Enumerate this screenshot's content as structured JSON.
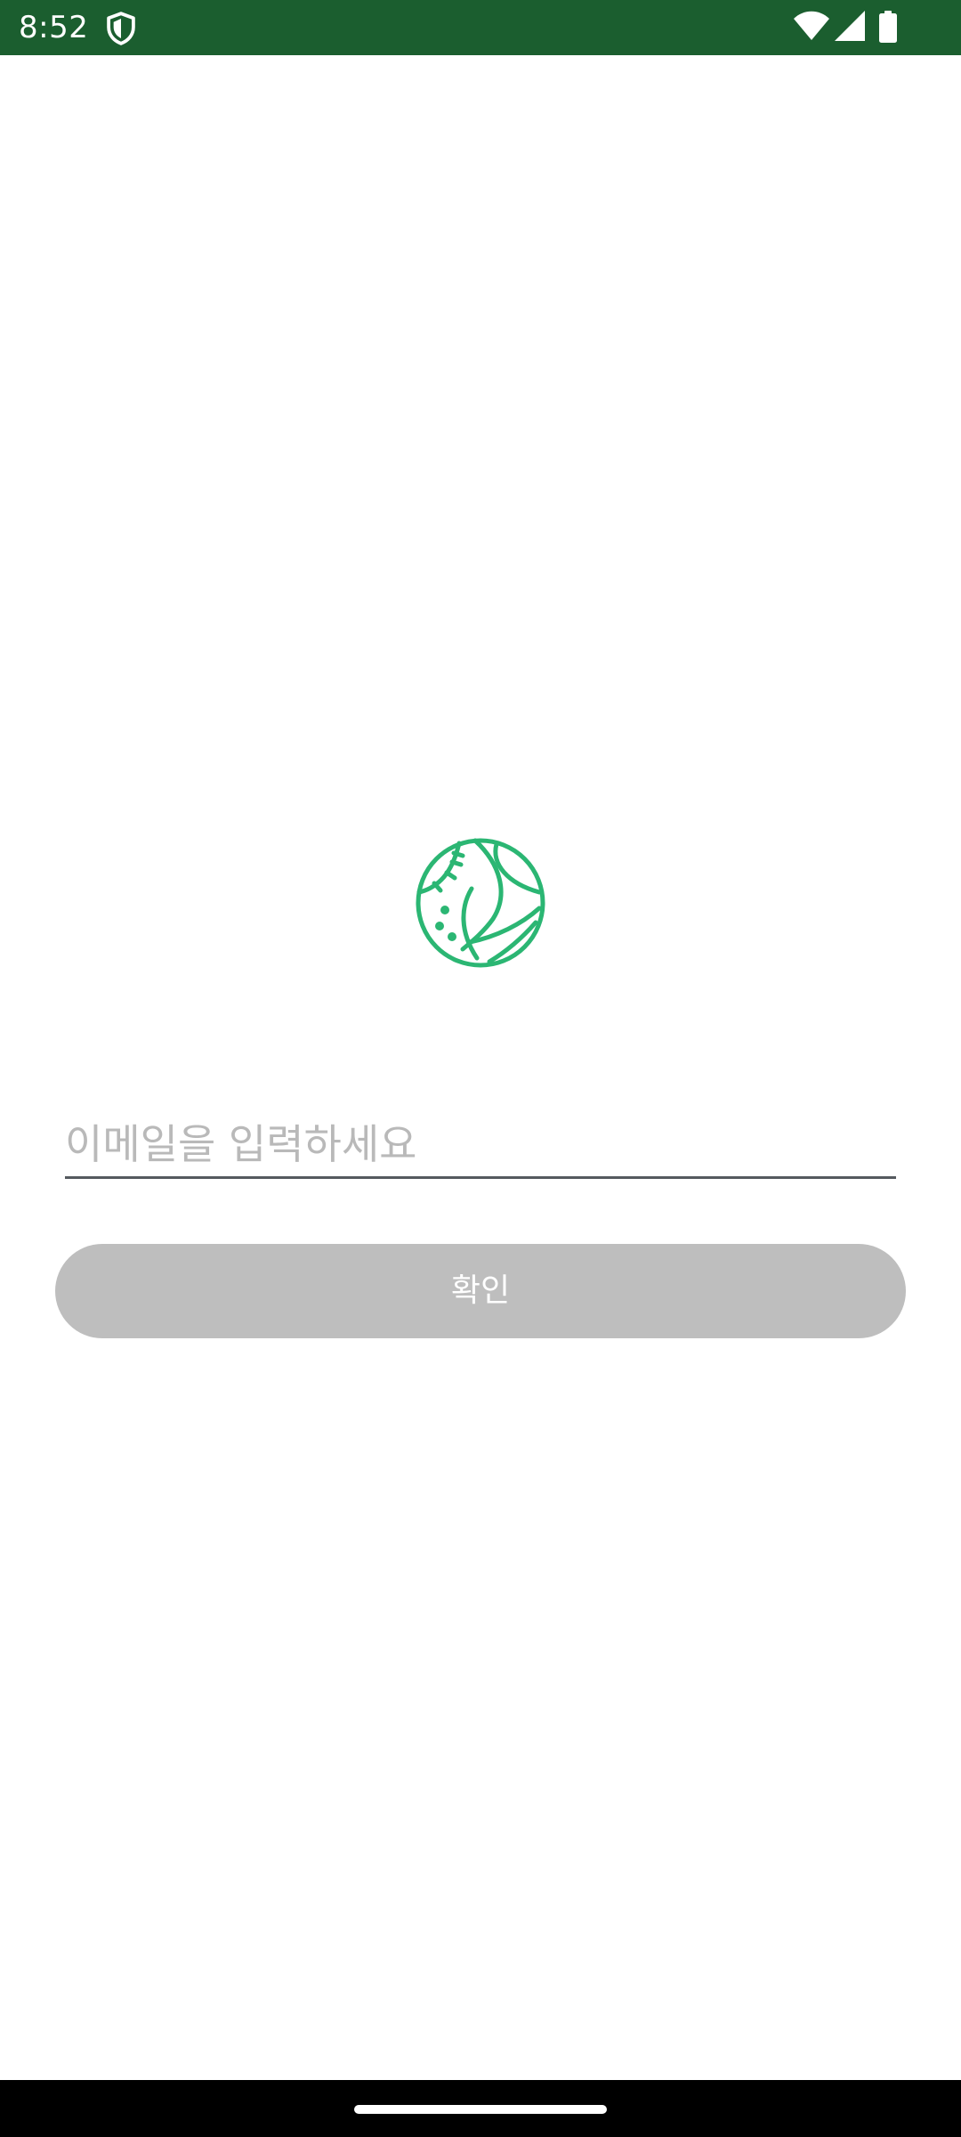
{
  "status_bar": {
    "time": "8:52",
    "background": "#1b5e2f",
    "icons": [
      "shield-icon",
      "wifi-icon",
      "signal-icon",
      "battery-icon"
    ]
  },
  "logo": {
    "icon": "baseball-volleyball-icon",
    "color": "#2bb673"
  },
  "email": {
    "value": "",
    "placeholder": "이메일을 입력하세요"
  },
  "confirm_button": {
    "label": "확인",
    "background": "#bebebe"
  },
  "navigation_bar": {
    "background": "#000000"
  }
}
